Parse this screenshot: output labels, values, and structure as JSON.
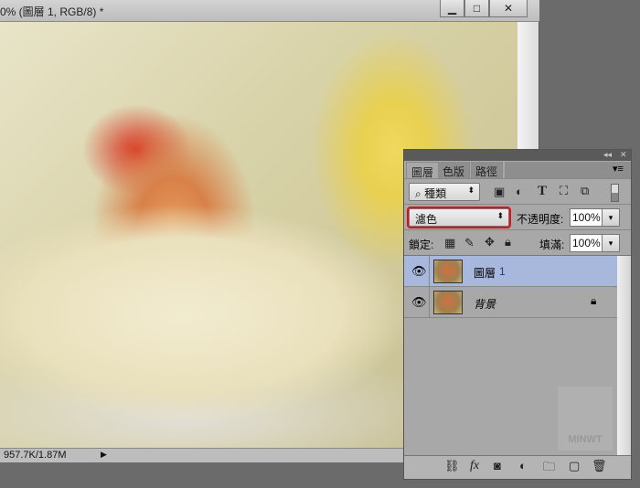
{
  "document": {
    "title": "0% (圖層 1, RGB/8) *",
    "minimize": "▁",
    "maximize": "□",
    "close": "✕",
    "status": "957.7K/1.87M",
    "status_arrow": "▶"
  },
  "panel": {
    "collapse": "◂◂",
    "close": "✕",
    "menu": "▾≡",
    "tabs": [
      {
        "label": "圖層"
      },
      {
        "label": "色版"
      },
      {
        "label": "路徑"
      }
    ],
    "filter": {
      "label": "種類",
      "icons": [
        "image-filter-icon",
        "adjustment-filter-icon",
        "type-filter-icon",
        "shape-filter-icon",
        "smart-object-filter-icon"
      ]
    },
    "blend_mode": "濾色",
    "opacity_label": "不透明度:",
    "opacity": "100%",
    "lock_label": "鎖定:",
    "fill_label": "填滿:",
    "fill": "100%",
    "layers": [
      {
        "name": "圖層",
        "suffix": "1",
        "selected": true,
        "visible": true
      },
      {
        "name": "背景",
        "locked": true,
        "visible": true
      }
    ],
    "watermark": "MINWT",
    "footer_icons": [
      "link-icon",
      "fx-icon",
      "mask-icon",
      "adjustment-icon",
      "folder-icon",
      "new-layer-icon",
      "trash-icon"
    ],
    "accent": "#a8b8dc",
    "highlight_border": "#e0101a"
  }
}
